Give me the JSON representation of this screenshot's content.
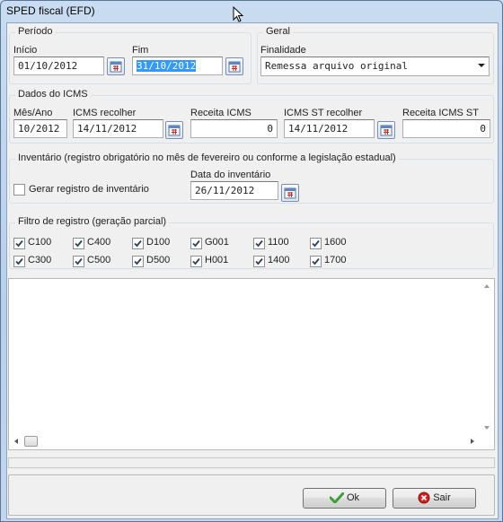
{
  "window": {
    "title": "SPED fiscal (EFD)"
  },
  "periodo": {
    "title": "Período",
    "inicio_label": "Início",
    "inicio_value": "01/10/2012",
    "fim_label": "Fim",
    "fim_value": "31/10/2012"
  },
  "geral": {
    "title": "Geral",
    "finalidade_label": "Finalidade",
    "finalidade_value": "Remessa arquivo original"
  },
  "icms": {
    "title": "Dados do ICMS",
    "mes_ano_label": "Mês/Ano",
    "mes_ano_value": "10/2012",
    "icms_recolher_label": "ICMS recolher",
    "icms_recolher_value": "14/11/2012",
    "receita_icms_label": "Receita ICMS",
    "receita_icms_value": "0",
    "icms_st_recolher_label": "ICMS ST recolher",
    "icms_st_recolher_value": "14/11/2012",
    "receita_icms_st_label": "Receita ICMS ST",
    "receita_icms_st_value": "0"
  },
  "inventario": {
    "title": "Inventário (registro obrigatório no mês de fevereiro ou conforme a legislação estadual)",
    "gerar_label": "Gerar registro de inventário",
    "gerar_checked": false,
    "data_label": "Data do inventário",
    "data_value": "26/11/2012"
  },
  "filtro": {
    "title": "Filtro de registro (geração parcial)",
    "items": [
      {
        "label": "C100",
        "checked": true
      },
      {
        "label": "C400",
        "checked": true
      },
      {
        "label": "D100",
        "checked": true
      },
      {
        "label": "G001",
        "checked": true
      },
      {
        "label": "1100",
        "checked": true
      },
      {
        "label": "1600",
        "checked": true
      },
      {
        "label": "C300",
        "checked": true
      },
      {
        "label": "C500",
        "checked": true
      },
      {
        "label": "D500",
        "checked": true
      },
      {
        "label": "H001",
        "checked": true
      },
      {
        "label": "1400",
        "checked": true
      },
      {
        "label": "1700",
        "checked": true
      }
    ]
  },
  "buttons": {
    "ok_label": "Ok",
    "sair_label": "Sair"
  },
  "colors": {
    "selection": "#3399ff",
    "ok_icon": "#3aa13a",
    "exit_icon": "#d22020",
    "calendar_icon": "#c8281e"
  }
}
